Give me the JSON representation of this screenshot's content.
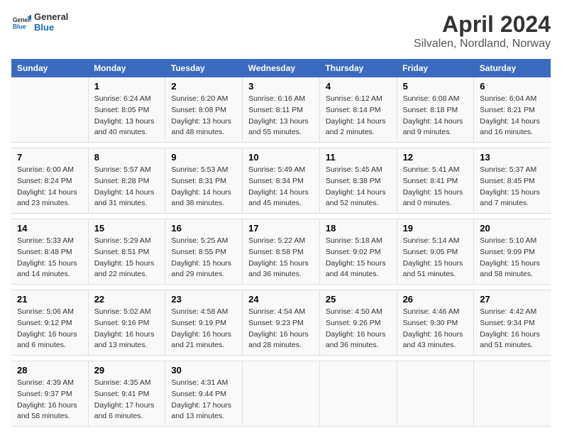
{
  "header": {
    "logo_line1": "General",
    "logo_line2": "Blue",
    "title": "April 2024",
    "subtitle": "Silvalen, Nordland, Norway"
  },
  "days_of_week": [
    "Sunday",
    "Monday",
    "Tuesday",
    "Wednesday",
    "Thursday",
    "Friday",
    "Saturday"
  ],
  "weeks": [
    [
      {
        "day": "",
        "info": ""
      },
      {
        "day": "1",
        "info": "Sunrise: 6:24 AM\nSunset: 8:05 PM\nDaylight: 13 hours\nand 40 minutes."
      },
      {
        "day": "2",
        "info": "Sunrise: 6:20 AM\nSunset: 8:08 PM\nDaylight: 13 hours\nand 48 minutes."
      },
      {
        "day": "3",
        "info": "Sunrise: 6:16 AM\nSunset: 8:11 PM\nDaylight: 13 hours\nand 55 minutes."
      },
      {
        "day": "4",
        "info": "Sunrise: 6:12 AM\nSunset: 8:14 PM\nDaylight: 14 hours\nand 2 minutes."
      },
      {
        "day": "5",
        "info": "Sunrise: 6:08 AM\nSunset: 8:18 PM\nDaylight: 14 hours\nand 9 minutes."
      },
      {
        "day": "6",
        "info": "Sunrise: 6:04 AM\nSunset: 8:21 PM\nDaylight: 14 hours\nand 16 minutes."
      }
    ],
    [
      {
        "day": "7",
        "info": "Sunrise: 6:00 AM\nSunset: 8:24 PM\nDaylight: 14 hours\nand 23 minutes."
      },
      {
        "day": "8",
        "info": "Sunrise: 5:57 AM\nSunset: 8:28 PM\nDaylight: 14 hours\nand 31 minutes."
      },
      {
        "day": "9",
        "info": "Sunrise: 5:53 AM\nSunset: 8:31 PM\nDaylight: 14 hours\nand 38 minutes."
      },
      {
        "day": "10",
        "info": "Sunrise: 5:49 AM\nSunset: 8:34 PM\nDaylight: 14 hours\nand 45 minutes."
      },
      {
        "day": "11",
        "info": "Sunrise: 5:45 AM\nSunset: 8:38 PM\nDaylight: 14 hours\nand 52 minutes."
      },
      {
        "day": "12",
        "info": "Sunrise: 5:41 AM\nSunset: 8:41 PM\nDaylight: 15 hours\nand 0 minutes."
      },
      {
        "day": "13",
        "info": "Sunrise: 5:37 AM\nSunset: 8:45 PM\nDaylight: 15 hours\nand 7 minutes."
      }
    ],
    [
      {
        "day": "14",
        "info": "Sunrise: 5:33 AM\nSunset: 8:48 PM\nDaylight: 15 hours\nand 14 minutes."
      },
      {
        "day": "15",
        "info": "Sunrise: 5:29 AM\nSunset: 8:51 PM\nDaylight: 15 hours\nand 22 minutes."
      },
      {
        "day": "16",
        "info": "Sunrise: 5:25 AM\nSunset: 8:55 PM\nDaylight: 15 hours\nand 29 minutes."
      },
      {
        "day": "17",
        "info": "Sunrise: 5:22 AM\nSunset: 8:58 PM\nDaylight: 15 hours\nand 36 minutes."
      },
      {
        "day": "18",
        "info": "Sunrise: 5:18 AM\nSunset: 9:02 PM\nDaylight: 15 hours\nand 44 minutes."
      },
      {
        "day": "19",
        "info": "Sunrise: 5:14 AM\nSunset: 9:05 PM\nDaylight: 15 hours\nand 51 minutes."
      },
      {
        "day": "20",
        "info": "Sunrise: 5:10 AM\nSunset: 9:09 PM\nDaylight: 15 hours\nand 58 minutes."
      }
    ],
    [
      {
        "day": "21",
        "info": "Sunrise: 5:06 AM\nSunset: 9:12 PM\nDaylight: 16 hours\nand 6 minutes."
      },
      {
        "day": "22",
        "info": "Sunrise: 5:02 AM\nSunset: 9:16 PM\nDaylight: 16 hours\nand 13 minutes."
      },
      {
        "day": "23",
        "info": "Sunrise: 4:58 AM\nSunset: 9:19 PM\nDaylight: 16 hours\nand 21 minutes."
      },
      {
        "day": "24",
        "info": "Sunrise: 4:54 AM\nSunset: 9:23 PM\nDaylight: 16 hours\nand 28 minutes."
      },
      {
        "day": "25",
        "info": "Sunrise: 4:50 AM\nSunset: 9:26 PM\nDaylight: 16 hours\nand 36 minutes."
      },
      {
        "day": "26",
        "info": "Sunrise: 4:46 AM\nSunset: 9:30 PM\nDaylight: 16 hours\nand 43 minutes."
      },
      {
        "day": "27",
        "info": "Sunrise: 4:42 AM\nSunset: 9:34 PM\nDaylight: 16 hours\nand 51 minutes."
      }
    ],
    [
      {
        "day": "28",
        "info": "Sunrise: 4:39 AM\nSunset: 9:37 PM\nDaylight: 16 hours\nand 58 minutes."
      },
      {
        "day": "29",
        "info": "Sunrise: 4:35 AM\nSunset: 9:41 PM\nDaylight: 17 hours\nand 6 minutes."
      },
      {
        "day": "30",
        "info": "Sunrise: 4:31 AM\nSunset: 9:44 PM\nDaylight: 17 hours\nand 13 minutes."
      },
      {
        "day": "",
        "info": ""
      },
      {
        "day": "",
        "info": ""
      },
      {
        "day": "",
        "info": ""
      },
      {
        "day": "",
        "info": ""
      }
    ]
  ]
}
